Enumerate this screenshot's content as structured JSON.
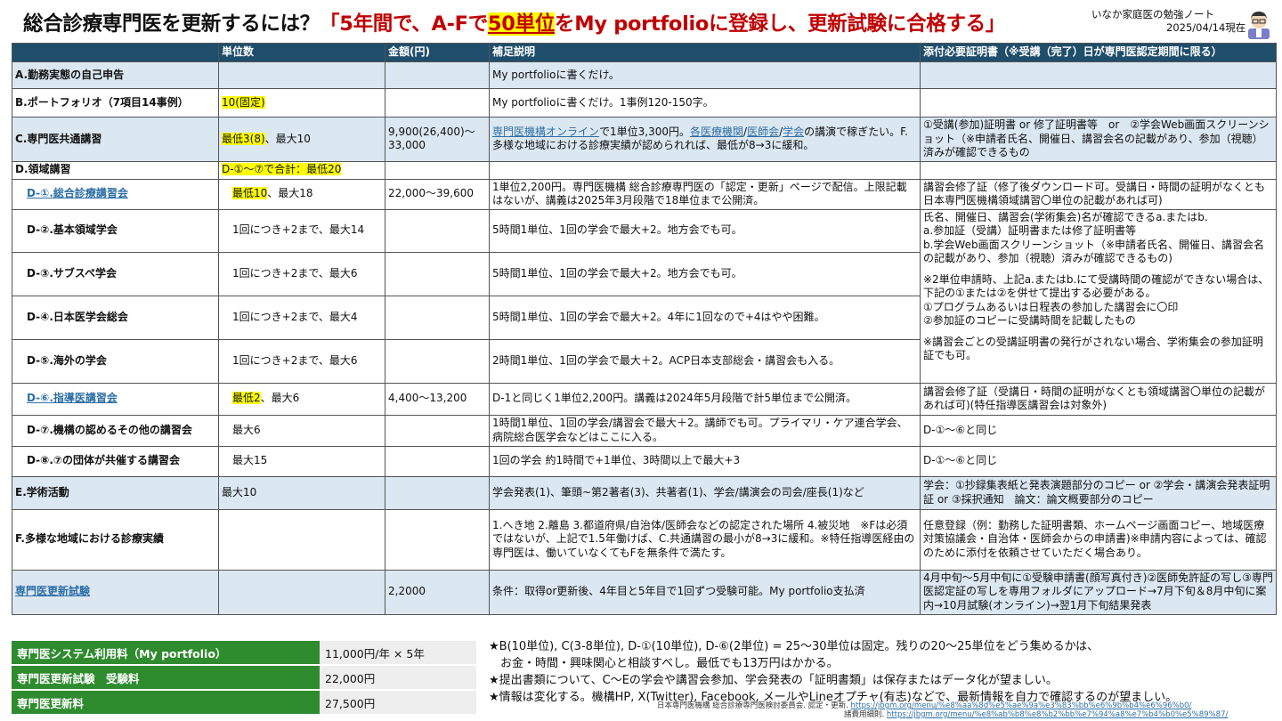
{
  "header": {
    "title_main": "総合診療専門医を更新するには？",
    "title_q1": "「5年間で、A-Fで",
    "title_hl": "50単位",
    "title_q2": "をMy portfolioに登録し、更新試験に合格する」",
    "site": "いなか家庭医の勉強ノート",
    "date": "2025/04/14現在"
  },
  "columns": [
    "",
    "単位数",
    "金額(円)",
    "補足説明",
    "添付必要証明書（※受講（完了）日が専門医認定期間に限る）"
  ],
  "rows": {
    "a": {
      "name": "A.勤務実態の自己申告",
      "note": "My portfolioに書くだけ。"
    },
    "b": {
      "name": "B.ポートフォリオ（7項目14事例）",
      "units": "10(固定)",
      "note": "My portfolioに書くだけ。1事例120-150字。"
    },
    "c": {
      "name": "C.専門医共通講習",
      "units_hl": "最低3(8)",
      "units_rest": "、最大10",
      "price": "9,900(26,400)～33,000",
      "note_link1": "専門医機構オンライン",
      "note_t1": "で1単位3,300円。",
      "note_link2": "各医療機関",
      "note_sep1": "/",
      "note_link3": "医師会",
      "note_sep2": "/",
      "note_link4": "学会",
      "note_t2": "の講演で稼ぎたい。F.多様な地域における診療実績が認められれば、最低が8→3に緩和。",
      "cert": "①受講(参加)証明書 or 修了証明書等　or　②学会Web画面スクリーンショット（※申請者氏名、開催日、講習会名の記載があり、参加（視聴）済みが確認できるもの"
    },
    "d": {
      "name": "D.領域講習",
      "units": "D-①～⑦で合計：最低20"
    },
    "d1": {
      "name": "D-①.総合診療講習会",
      "units_hl": "最低10",
      "units_rest": "、最大18",
      "price": "22,000～39,600",
      "note": "1単位2,200円。専門医機構 総合診療専門医の「認定・更新」ページで配信。上限記載はないが、講義は2025年3月段階で18単位まで公開済。",
      "cert": "講習会修了証（修了後ダウンロード可。受講日・時間の証明がなくとも日本専門医機構領域講習〇単位の記載があれば可)"
    },
    "d2": {
      "name": "D-②.基本領域学会",
      "units": "1回につき+2まで、最大14",
      "note": "5時間1単位、1回の学会で最大+2。地方会でも可。"
    },
    "d3": {
      "name": "D-③.サブスペ学会",
      "units": "1回につき+2まで、最大6",
      "note": "5時間1単位、1回の学会で最大+2。地方会でも可。"
    },
    "d4": {
      "name": "D-④.日本医学会総会",
      "units": "1回につき+2まで、最大4",
      "note": "5時間1単位、1回の学会で最大+2。4年に1回なので+4はやや困難。"
    },
    "d5": {
      "name": "D-⑤.海外の学会",
      "units": "1回につき+2まで、最大6",
      "note": "2時間1単位、1回の学会で最大＋2。ACP日本支部総会・講習会も入る。"
    },
    "d2to5_cert": [
      "氏名、開催日、講習会(学術集会)名が確認できるa.またはb.",
      "a.参加証（受講）証明書または修了証明書等",
      "b.学会Web画面スクリーンショット（※申請者氏名、開催日、講習会名の記載があり、参加（視聴）済みが確認できるもの)",
      "",
      "※2単位申請時、上記a.またはb.にて受講時間の確認ができない場合は、下記の①または②を併せて提出する必要がある。",
      "①プログラムあるいは日程表の参加した講習会に〇印",
      "②参加証のコピーに受講時間を記載したもの",
      "",
      "※講習会ごとの受講証明書の発行がされない場合、学術集会の参加証明証でも可。"
    ],
    "d6": {
      "name": "D-⑥.指導医講習会",
      "units_hl": "最低2",
      "units_rest": "、最大6",
      "price": "4,400～13,200",
      "note": "D-1と同じく1単位2,200円。講義は2024年5月段階で計5単位まで公開済。",
      "cert": "講習会修了証（受講日・時間の証明がなくとも領域講習〇単位の記載があれば可)(特任指導医講習会は対象外)"
    },
    "d7": {
      "name": "D-⑦.機構の認めるその他の講習会",
      "units": "最大6",
      "note": "1時間1単位、1回の学会/講習会で最大＋2。講師でも可。プライマリ・ケア連合学会、病院総合医学会などはここに入る。",
      "cert": "D-①～⑥と同じ"
    },
    "d8": {
      "name": "D-⑧.⑦の団体が共催する講習会",
      "units": "最大15",
      "note": "1回の学会 約1時間で+1単位、3時間以上で最大+3",
      "cert": "D-①～⑥と同じ"
    },
    "e": {
      "name": "E.学術活動",
      "units": "最大10",
      "note": "学会発表(1)、筆頭~第2著者(3)、共著者(1)、学会/講演会の司会/座長(1)など",
      "cert": "学会：①抄録集表紙と発表演題部分のコピー or ②学会・講演会発表証明証 or ③採択通知　論文：論文概要部分のコピー"
    },
    "f": {
      "name": "F.多様な地域における診療実績",
      "note": "1.へき地 2.離島 3.都道府県/自治体/医師会などの認定された場所 4.被災地　※Fは必須ではないが、上記で1.5年働けば、C.共通講習の最小が8→3に緩和。※特任指導医経由の専門医は、働いていなくてもFを無条件で満たす。",
      "cert": "任意登録（例：勤務した証明書類、ホームページ画面コピー、地域医療対策協議会・自治体・医師会からの申請書)※申請内容によっては、確認のために添付を依頼させていただく場合あり。"
    },
    "exam": {
      "name": "専門医更新試験",
      "price": "2,2000",
      "note": "条件：取得or更新後、4年目と5年目で1回ずつ受験可能。My portfolio支払済",
      "cert": "4月中旬～5月中旬に①受験申請書(顔写真付き)②医師免許証の写し③専門医認定証の写しを専用フォルダにアップロード→7月下旬＆8月中旬に案内→10月試験(オンライン)→翌1月下旬結果発表"
    }
  },
  "fees": [
    {
      "label": "専門医システム利用料（My portfolio）",
      "value": "11,000円/年 × 5年"
    },
    {
      "label": "専門医更新試験　受験料",
      "value": "22,000円"
    },
    {
      "label": "専門医更新料",
      "value": "27,500円"
    }
  ],
  "notes": [
    "★B(10単位), C(3-8単位), D-①(10単位), D-⑥(2単位) = 25～30単位は固定。残りの20～25単位をどう集めるかは、",
    "　お金・時間・興味関心と相談すべし。最低でも13万円はかかる。",
    "★提出書類について、C～Eの学会や講習会参加、学会発表の「証明書類」は保存またはデータ化が望ましい。",
    "★情報は変化する。機構HP, X(Twitter), Facebook, メールやLineオプチャ(有志)などで、最新情報を自力で確認するのが望ましい。"
  ],
  "sources": {
    "s1_label": "日本専門医機構 総合診療専門医検討委員会. 認定・更新.",
    "s1_url": "https://jbgm.org/menu/%e8%aa%8d%e5%ae%9a%e3%83%bb%e6%9b%b4%e6%96%b0/",
    "s2_label": "諸費用細則.",
    "s2_url": "https://jbgm.org/menu/%e8%ab%b8%e8%b2%bb%e7%94%a8%e7%b4%b0%e5%89%87/"
  }
}
